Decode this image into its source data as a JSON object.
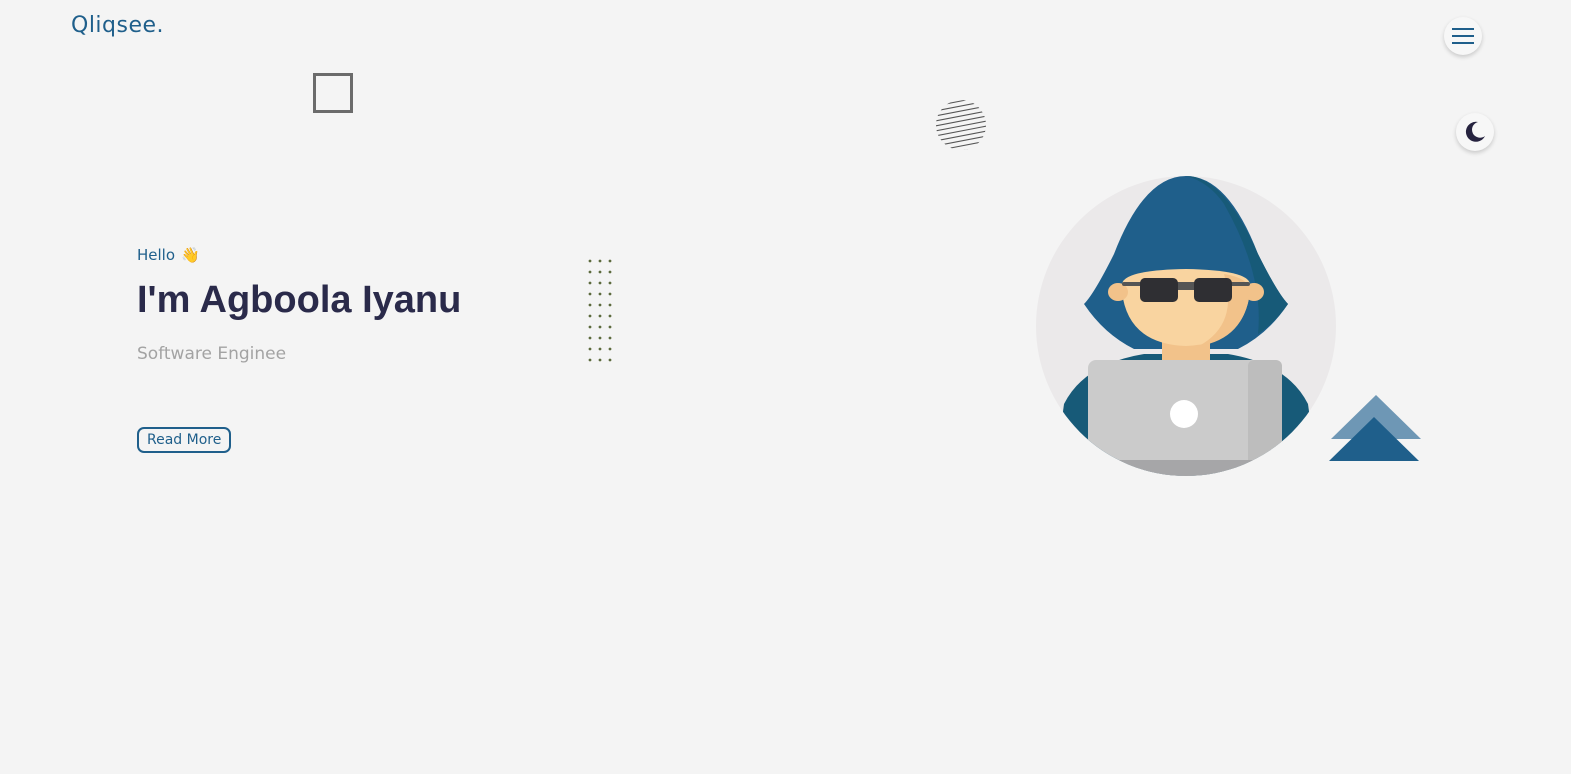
{
  "header": {
    "logo": "Qliqsee."
  },
  "hero": {
    "greeting": "Hello",
    "greeting_emoji": "👋",
    "headline": "I'm Agboola Iyanu",
    "subtitle": "Software Enginee",
    "cta_label": "Read More"
  },
  "icons": {
    "menu": "hamburger-menu-icon",
    "theme": "moon-icon"
  },
  "colors": {
    "accent": "#1f5f8b",
    "heading": "#2a2a4a",
    "muted": "#a3a3a3",
    "background": "#f4f4f4"
  }
}
